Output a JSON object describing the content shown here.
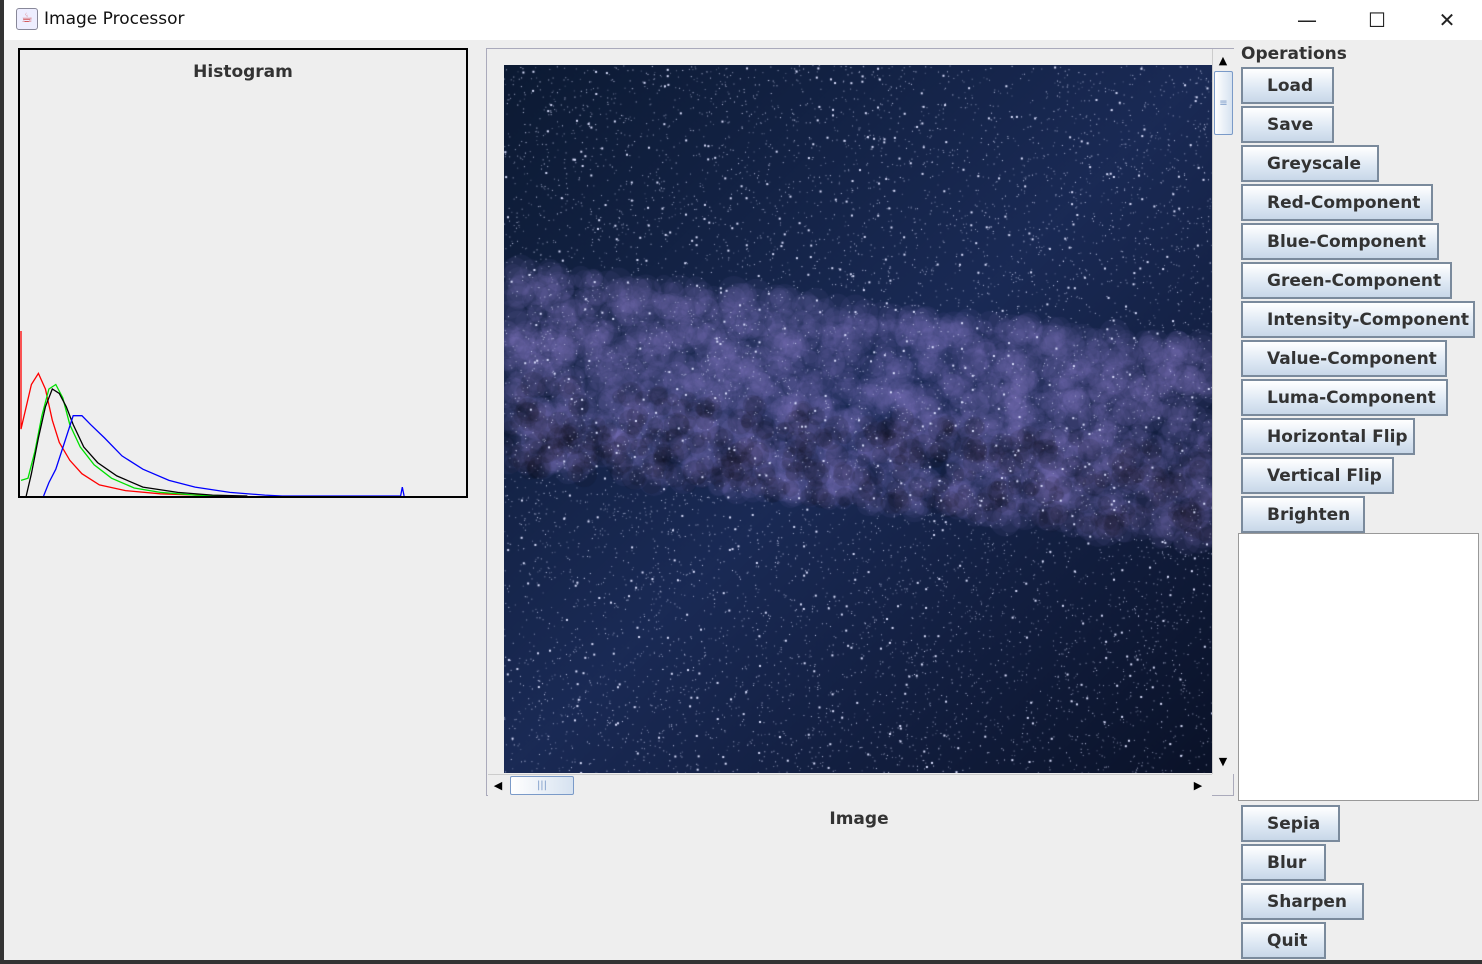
{
  "window": {
    "title": "Image Processor",
    "controls": {
      "minimize": "—",
      "maximize": "☐",
      "close": "✕"
    }
  },
  "histogram": {
    "title": "Histogram",
    "chart_data": {
      "type": "line",
      "title": "Histogram",
      "xlim": [
        0,
        255
      ],
      "ylim": [
        0,
        1
      ],
      "series": [
        {
          "name": "red",
          "color": "#ff0000",
          "points": [
            [
              0,
              0.37
            ],
            [
              0,
              0.15
            ],
            [
              3,
              0.2
            ],
            [
              6,
              0.25
            ],
            [
              10,
              0.275
            ],
            [
              14,
              0.24
            ],
            [
              18,
              0.17
            ],
            [
              22,
              0.12
            ],
            [
              28,
              0.08
            ],
            [
              35,
              0.05
            ],
            [
              45,
              0.025
            ],
            [
              60,
              0.012
            ],
            [
              80,
              0.005
            ],
            [
              110,
              0.001
            ],
            [
              120,
              0
            ]
          ]
        },
        {
          "name": "green",
          "color": "#00e000",
          "points": [
            [
              0,
              0.035
            ],
            [
              4,
              0.04
            ],
            [
              8,
              0.1
            ],
            [
              12,
              0.18
            ],
            [
              16,
              0.24
            ],
            [
              20,
              0.25
            ],
            [
              24,
              0.22
            ],
            [
              28,
              0.16
            ],
            [
              34,
              0.11
            ],
            [
              42,
              0.07
            ],
            [
              52,
              0.04
            ],
            [
              65,
              0.018
            ],
            [
              80,
              0.008
            ],
            [
              100,
              0.002
            ],
            [
              115,
              0
            ]
          ]
        },
        {
          "name": "intensity",
          "color": "#000000",
          "points": [
            [
              3,
              0
            ],
            [
              6,
              0.05
            ],
            [
              10,
              0.13
            ],
            [
              14,
              0.2
            ],
            [
              18,
              0.24
            ],
            [
              22,
              0.23
            ],
            [
              26,
              0.2
            ],
            [
              30,
              0.16
            ],
            [
              36,
              0.11
            ],
            [
              44,
              0.075
            ],
            [
              55,
              0.045
            ],
            [
              70,
              0.02
            ],
            [
              90,
              0.008
            ],
            [
              110,
              0.002
            ],
            [
              130,
              0
            ]
          ]
        },
        {
          "name": "blue",
          "color": "#0000ff",
          "points": [
            [
              13,
              0
            ],
            [
              16,
              0.03
            ],
            [
              20,
              0.06
            ],
            [
              25,
              0.12
            ],
            [
              30,
              0.18
            ],
            [
              35,
              0.18
            ],
            [
              40,
              0.16
            ],
            [
              48,
              0.13
            ],
            [
              58,
              0.09
            ],
            [
              70,
              0.06
            ],
            [
              85,
              0.035
            ],
            [
              100,
              0.02
            ],
            [
              120,
              0.008
            ],
            [
              140,
              0.002
            ],
            [
              150,
              0
            ],
            [
              218,
              0
            ],
            [
              219,
              0.02
            ],
            [
              220,
              0
            ]
          ]
        }
      ]
    }
  },
  "image": {
    "label": "Image",
    "scroll": {
      "up": "▲",
      "down": "▼",
      "left": "◀",
      "right": "▶",
      "grip_v": "≡",
      "grip_h": "|||"
    }
  },
  "operations": {
    "label": "Operations",
    "buttons": [
      "Load",
      "Save",
      "Greyscale",
      "Red-Component",
      "Blue-Component",
      "Green-Component",
      "Intensity-Component",
      "Value-Component",
      "Luma-Component",
      "Horizontal Flip",
      "Vertical Flip",
      "Brighten"
    ],
    "lower_buttons": [
      "Sepia",
      "Blur",
      "Sharpen",
      "Quit"
    ]
  }
}
